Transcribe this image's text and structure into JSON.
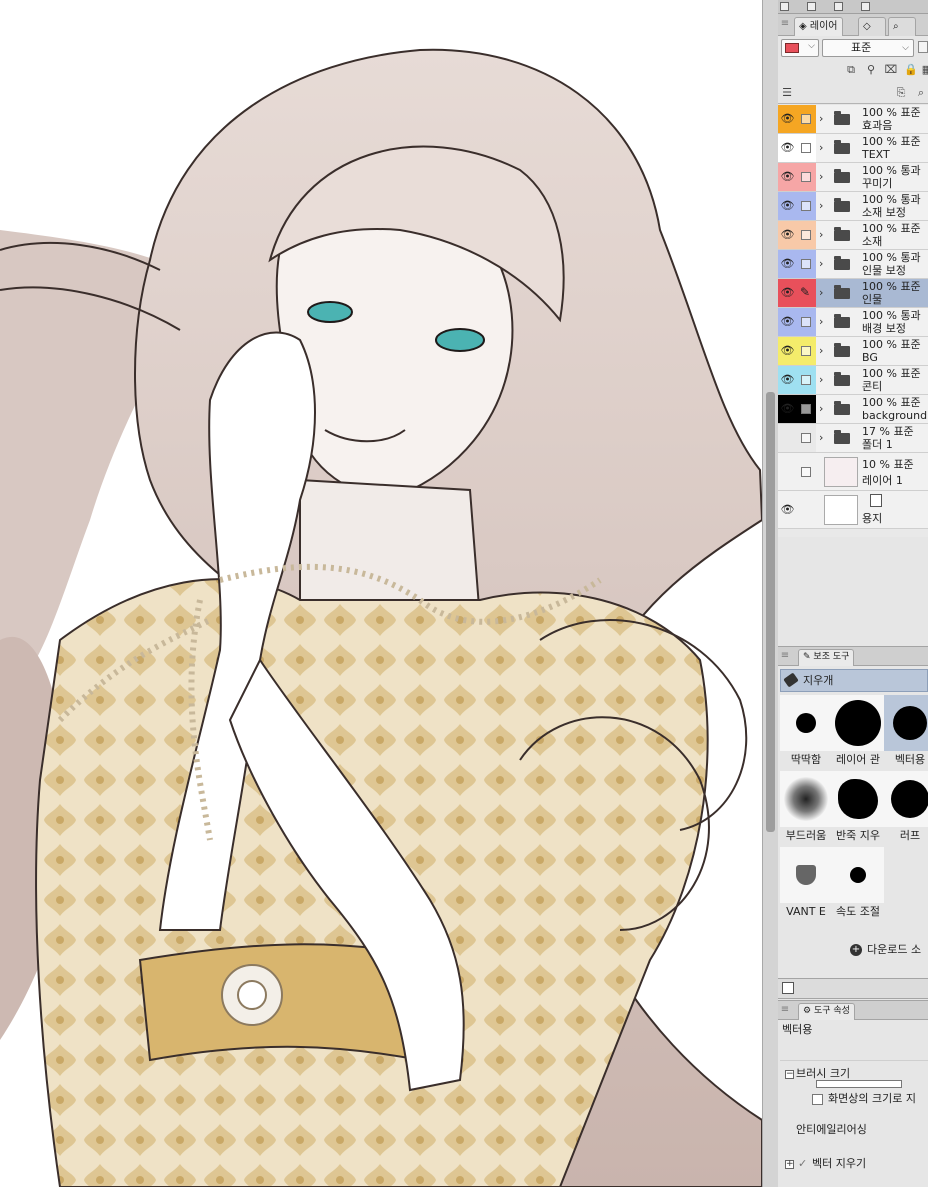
{
  "layer_panel": {
    "tab_label": "레이어",
    "blend_mode": "표준",
    "layers": [
      {
        "color": "#f5a623",
        "percent": "100 %",
        "mode": "표준",
        "name": "효과음"
      },
      {
        "color": "#ffffff",
        "percent": "100 %",
        "mode": "표준",
        "name": "TEXT"
      },
      {
        "color": "#f6a6a6",
        "percent": "100 %",
        "mode": "통과",
        "name": "꾸미기"
      },
      {
        "color": "#a9b8ef",
        "percent": "100 %",
        "mode": "통과",
        "name": "소재 보정"
      },
      {
        "color": "#f8c9a8",
        "percent": "100 %",
        "mode": "표준",
        "name": "소재"
      },
      {
        "color": "#a9b8ef",
        "percent": "100 %",
        "mode": "통과",
        "name": "인물 보정"
      },
      {
        "color": "#e8505b",
        "percent": "100 %",
        "mode": "표준",
        "name": "인물"
      },
      {
        "color": "#a9b8ef",
        "percent": "100 %",
        "mode": "통과",
        "name": "배경 보정"
      },
      {
        "color": "#f4ec6b",
        "percent": "100 %",
        "mode": "표준",
        "name": "BG"
      },
      {
        "color": "#9fe0f1",
        "percent": "100 %",
        "mode": "표준",
        "name": "콘티"
      },
      {
        "color": "#000000",
        "percent": "100 %",
        "mode": "표준",
        "name": "background"
      },
      {
        "color": "#e9e9e9",
        "percent": "17 %",
        "mode": "표준",
        "name": "폴더 1"
      }
    ],
    "raster_layer": {
      "percent": "10 %",
      "mode": "표준",
      "name": "레이어 1"
    },
    "paper_layer": {
      "name": "용지"
    }
  },
  "subtool_panel": {
    "tab_label": "보조 도구",
    "tool_name": "지우개",
    "brushes": [
      {
        "name": "딱딱함"
      },
      {
        "name": "레이어 관"
      },
      {
        "name": "벡터용"
      },
      {
        "name": "부드러움"
      },
      {
        "name": "반죽 지우"
      },
      {
        "name": "러프"
      },
      {
        "name": "VANT E"
      },
      {
        "name": "속도 조절"
      }
    ],
    "download_label": "다운로드 소"
  },
  "tool_property": {
    "tab_label": "도구 속성",
    "tool_name": "벡터용",
    "brush_size_label": "브러시 크기",
    "screen_size_label": "화면상의 크기로 지",
    "antialias_label": "안티에일리어싱",
    "vector_erase_label": "벡터 지우기"
  },
  "colors": {
    "selected_layer": "#a9b9d3",
    "panel_bg": "#e6e6e6"
  }
}
